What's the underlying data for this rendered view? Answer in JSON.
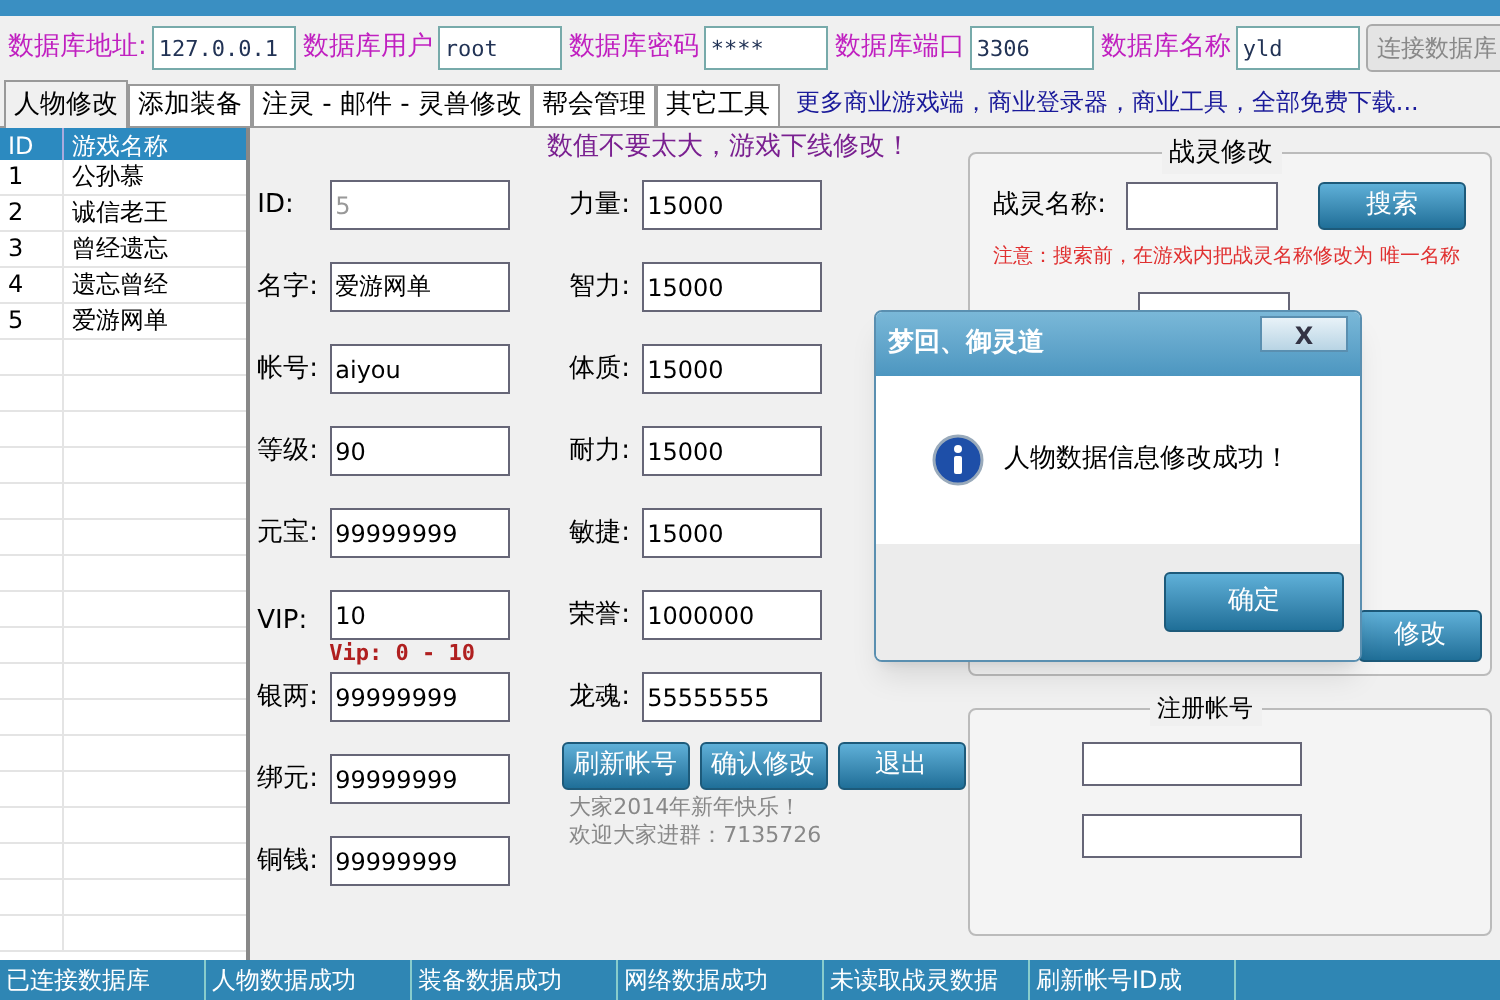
{
  "db_bar": {
    "fields": [
      {
        "label": "数据库地址:",
        "value": "127.0.0.1"
      },
      {
        "label": "数据库用户",
        "value": "root"
      },
      {
        "label": "数据库密码",
        "value": "****"
      },
      {
        "label": "数据库端口",
        "value": "3306"
      },
      {
        "label": "数据库名称",
        "value": "yld"
      }
    ],
    "connect_button": {
      "label": "连接数据库",
      "disabled": true
    }
  },
  "tabs": [
    {
      "label": "人物修改",
      "selected": true
    },
    {
      "label": "添加装备",
      "selected": false
    },
    {
      "label": "注灵 - 邮件 - 灵兽修改",
      "selected": false
    },
    {
      "label": "帮会管理",
      "selected": false
    },
    {
      "label": "其它工具",
      "selected": false
    }
  ],
  "promo_link": "更多商业游戏端，商业登录器，商业工具，全部免费下载...",
  "character_list": {
    "columns": [
      "ID",
      "游戏名称"
    ],
    "rows": [
      [
        "1",
        "公孙慕"
      ],
      [
        "2",
        "诚信老王"
      ],
      [
        "3",
        "曾经遗忘"
      ],
      [
        "4",
        "遗忘曾经"
      ],
      [
        "5",
        "爱游网单"
      ]
    ]
  },
  "warning": "数值不要太大，游戏下线修改！",
  "form": {
    "left": [
      {
        "label": "ID:",
        "value": "5",
        "disabled": true
      },
      {
        "label": "名字:",
        "value": "爱游网单",
        "disabled": false
      },
      {
        "label": "帐号:",
        "value": "aiyou",
        "disabled": false
      },
      {
        "label": "等级:",
        "value": "90",
        "disabled": false
      },
      {
        "label": "元宝:",
        "value": "99999999",
        "disabled": false
      },
      {
        "label": "VIP:",
        "value": "10",
        "disabled": false,
        "hint": "Vip: 0 - 10"
      },
      {
        "label": "银两:",
        "value": "99999999",
        "disabled": false
      },
      {
        "label": "绑元:",
        "value": "99999999",
        "disabled": false
      },
      {
        "label": "铜钱:",
        "value": "99999999",
        "disabled": false
      }
    ],
    "right": [
      {
        "label": "力量:",
        "value": "15000"
      },
      {
        "label": "智力:",
        "value": "15000"
      },
      {
        "label": "体质:",
        "value": "15000"
      },
      {
        "label": "耐力:",
        "value": "15000"
      },
      {
        "label": "敏捷:",
        "value": "15000"
      },
      {
        "label": "荣誉:",
        "value": "1000000"
      },
      {
        "label": "龙魂:",
        "value": "55555555"
      }
    ]
  },
  "buttons": [
    "刷新帐号",
    "确认修改",
    "退出"
  ],
  "notice": [
    "大家2014年新年快乐！",
    "欢迎大家进群：7135726"
  ],
  "spirit_panel": {
    "title": "战灵修改",
    "name_label": "战灵名称:",
    "search_button": "搜索",
    "note": "注意：搜索前，在游戏内把战灵名称修改为 唯一名称",
    "confirm_button": "修改"
  },
  "register_panel": {
    "title": "注册帐号"
  },
  "dialog": {
    "title": "梦回、御灵道",
    "close": "X",
    "message": "人物数据信息修改成功！",
    "ok_button": "确定"
  },
  "status_bar": [
    "已连接数据库",
    "人物数据成功",
    "装备数据成功",
    "网络数据成功",
    "未读取战灵数据",
    "刷新帐号ID成"
  ]
}
